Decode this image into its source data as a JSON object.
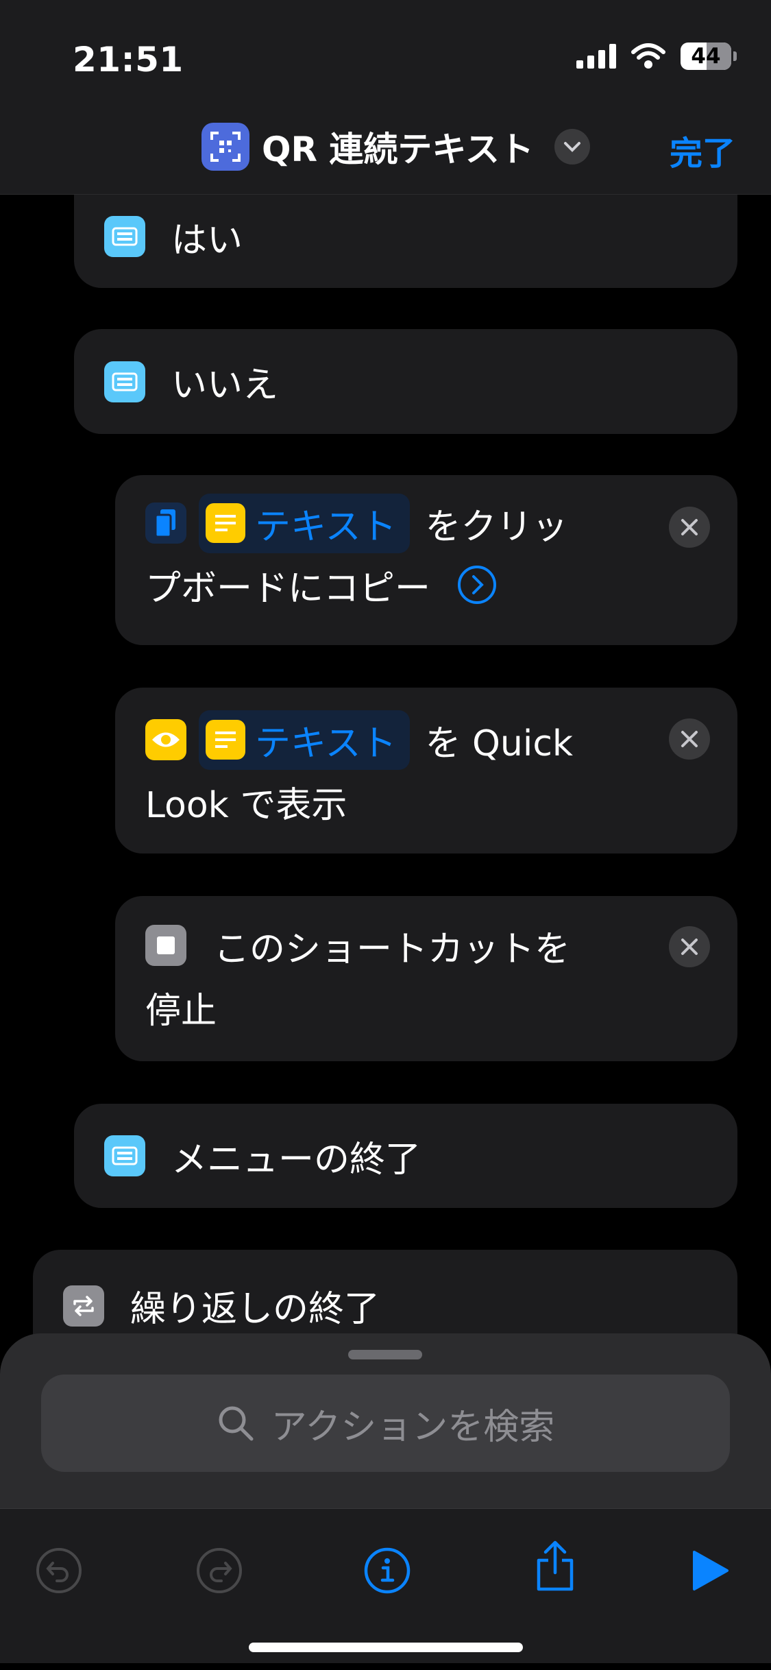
{
  "status_bar": {
    "time": "21:51",
    "battery": "44"
  },
  "nav": {
    "title": "QR 連続テキスト",
    "done_label": "完了"
  },
  "actions": {
    "menu_yes": "はい",
    "menu_no": "いいえ",
    "copy": {
      "token": "テキスト",
      "text_line1": "をクリッ",
      "text_line2": "プボードにコピー"
    },
    "quicklook": {
      "token": "テキスト",
      "text_line1": "を Quick",
      "text_line2": "Look で表示"
    },
    "stop": {
      "text_line1": "このショートカットを",
      "text_line2": "停止"
    },
    "end_menu": "メニューの終了",
    "end_repeat": "繰り返しの終了"
  },
  "search": {
    "placeholder": "アクションを検索"
  },
  "colors": {
    "accent": "#0a84ff",
    "menu_icon": "#5ac8fa",
    "variable_icon": "#ffcc00",
    "app_icon": "#4d6bdc"
  },
  "icons": {
    "undo": "undo-icon",
    "redo": "redo-icon",
    "info": "info-icon",
    "share": "share-icon",
    "play": "play-icon"
  }
}
